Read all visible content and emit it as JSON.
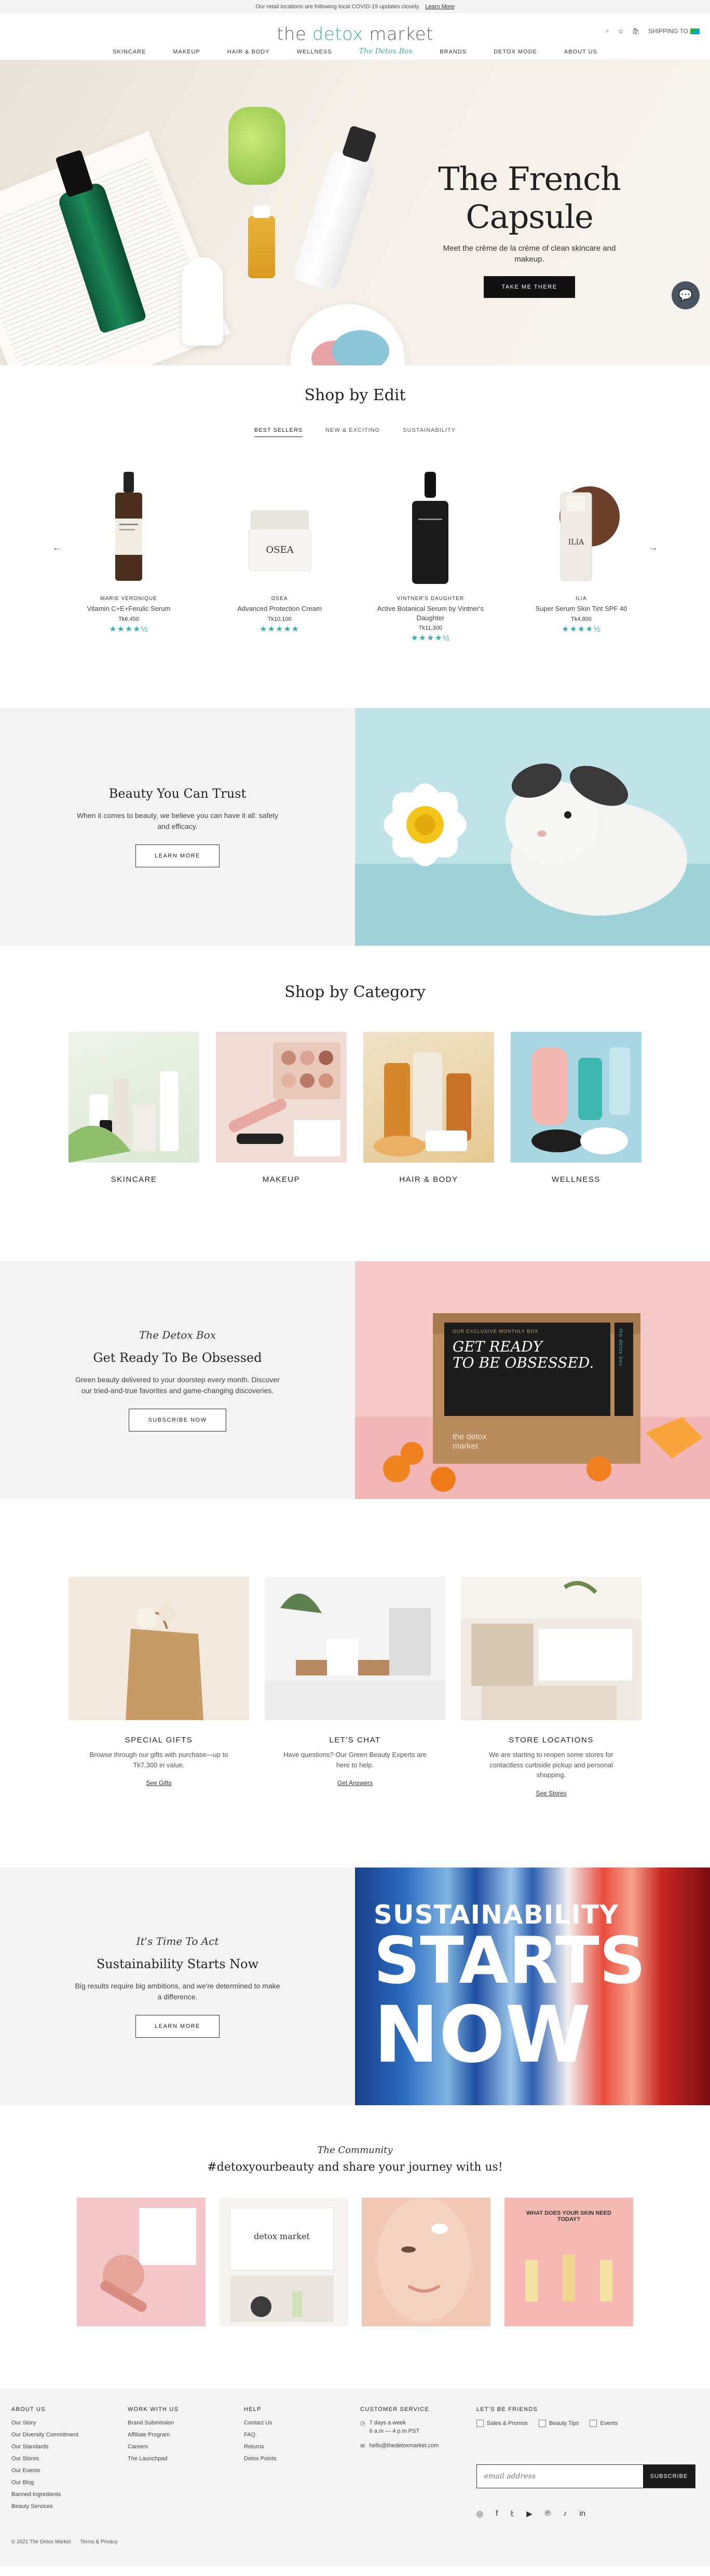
{
  "announcement": {
    "text": "Our retail locations are following local COVID-19 updates closely.",
    "link": "Learn More"
  },
  "header": {
    "logo_a": "the ",
    "logo_b": "detox",
    "logo_c": " market",
    "shipping": "SHIPPING TO",
    "nav": [
      "SKINCARE",
      "MAKEUP",
      "HAIR & BODY",
      "WELLNESS",
      "The Detox Box",
      "BRANDS",
      "DETOX MODE",
      "ABOUT US"
    ]
  },
  "hero": {
    "title": "The French Capsule",
    "subtitle": "Meet the crème de la crème of clean skincare and makeup.",
    "cta": "TAKE ME THERE"
  },
  "edit": {
    "title": "Shop by Edit",
    "tabs": [
      "BEST SELLERS",
      "NEW & EXCITING",
      "SUSTAINABILITY"
    ],
    "products": [
      {
        "brand": "MARIE VERONIQUE",
        "name": "Vitamin C+E+Ferulic Serum",
        "price": "Tk6,450",
        "stars": "★★★★½",
        "rating": 4.5
      },
      {
        "brand": "OSEA",
        "name": "Advanced Protection Cream",
        "price": "Tk10,100",
        "stars": "★★★★★",
        "rating": 5
      },
      {
        "brand": "VINTNER'S DAUGHTER",
        "name": "Active Botanical Serum by Vintner's Daughter",
        "price": "Tk11,300",
        "stars": "★★★★½",
        "rating": 4.5
      },
      {
        "brand": "ILIA",
        "name": "Super Serum Skin Tint SPF 40",
        "price": "Tk4,800",
        "stars": "★★★★½",
        "rating": 4.5
      }
    ]
  },
  "trust": {
    "title": "Beauty You Can Trust",
    "text": "When it comes to beauty, we believe you can have it all: safety and efficacy.",
    "cta": "LEARN MORE"
  },
  "categories": {
    "title": "Shop by Category",
    "items": [
      "SKINCARE",
      "MAKEUP",
      "HAIR & BODY",
      "WELLNESS"
    ]
  },
  "detoxbox": {
    "script": "The Detox Box",
    "title": "Get Ready To Be Obsessed",
    "text": "Green beauty delivered to your doorstep every month. Discover our tried-and-true favorites and game-changing discoveries.",
    "cta": "SUBSCRIBE NOW",
    "box_top": "OUR EXCLUSIVE MONTHLY BOX",
    "box_line1": "GET READY",
    "box_line2": "TO BE OBSESSED.",
    "box_side": "the detox box",
    "box_logo": "the detox market"
  },
  "features": [
    {
      "title": "SPECIAL GIFTS",
      "text": "Browse through our gifts with purchase—up to Tk7,300 in value.",
      "link": "See Gifts"
    },
    {
      "title": "LET'S CHAT",
      "text": "Have questions? Our Green Beauty Experts are here to help.",
      "link": "Get Answers"
    },
    {
      "title": "STORE LOCATIONS",
      "text": "We are starting to reopen some stores for contactless curbside pickup and personal shopping.",
      "link": "See Stores"
    }
  ],
  "sustain": {
    "script": "It's Time To Act",
    "title": "Sustainability Starts Now",
    "text": "Big results require big ambitions, and we're determined to make a difference.",
    "cta": "LEARN MORE",
    "poster1": "SUSTAINABILITY",
    "poster2": "STARTS",
    "poster3": "NOW"
  },
  "community": {
    "script": "The Community",
    "title": "#detoxyourbeauty and share your journey with us!",
    "post4": "WHAT DOES YOUR SKIN NEED TODAY?"
  },
  "footer": {
    "about": {
      "title": "ABOUT US",
      "items": [
        "Our Story",
        "Our Diversity Commitment",
        "Our Standards",
        "Our Stores",
        "Our Events",
        "Our Blog",
        "Banned Ingredients",
        "Beauty Services"
      ]
    },
    "more": {
      "title": "WORK WITH US",
      "items": [
        "Brand Submission",
        "Affiliate Program",
        "Careers",
        "The Launchpad"
      ]
    },
    "help": {
      "title": "HELP",
      "items": [
        "Contact Us",
        "FAQ",
        "Returns",
        "Detox Points"
      ]
    },
    "service": {
      "title": "CUSTOMER SERVICE",
      "hours1": "7 days a week",
      "hours2": "6 a.m — 4 p.m PST",
      "email": "hello@thedetoxmarket.com"
    },
    "friends": {
      "title": "LET'S BE FRIENDS",
      "checks": [
        "Sales & Promos",
        "Beauty Tips",
        "Events"
      ],
      "placeholder": "email address",
      "submit": "SUBSCRIBE"
    },
    "copyright": "© 2021 The Detox Market",
    "terms": "Terms & Privacy"
  },
  "colors": {
    "teal": "#3bb0a8",
    "dark": "#111111",
    "panel": "#f4f4f4"
  }
}
